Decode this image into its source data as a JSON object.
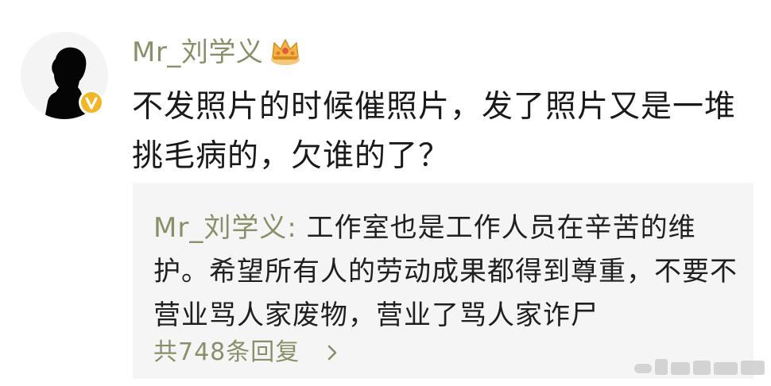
{
  "post": {
    "username": "Mr_刘学义",
    "text": "不发照片的时候催照片，发了照片又是一堆挑毛病的，欠谁的了？"
  },
  "reply": {
    "author": "Mr_刘学义",
    "separator": ": ",
    "text": "工作室也是工作人员在辛苦的维护。希望所有人的劳动成果都得到尊重，不要不营业骂人家废物，营业了骂人家诈尸",
    "more_label": "共748条回复"
  },
  "icons": {
    "avatar": "silhouette-avatar",
    "verified": "verified-badge-icon",
    "crown": "crown-icon",
    "chevron": "chevron-right-icon",
    "watermark": "watermark-icon"
  },
  "colors": {
    "username": "#8a8f6a",
    "text": "#1a1a1a",
    "reply_bg": "#f5f5f5",
    "badge": "#f2b728"
  }
}
